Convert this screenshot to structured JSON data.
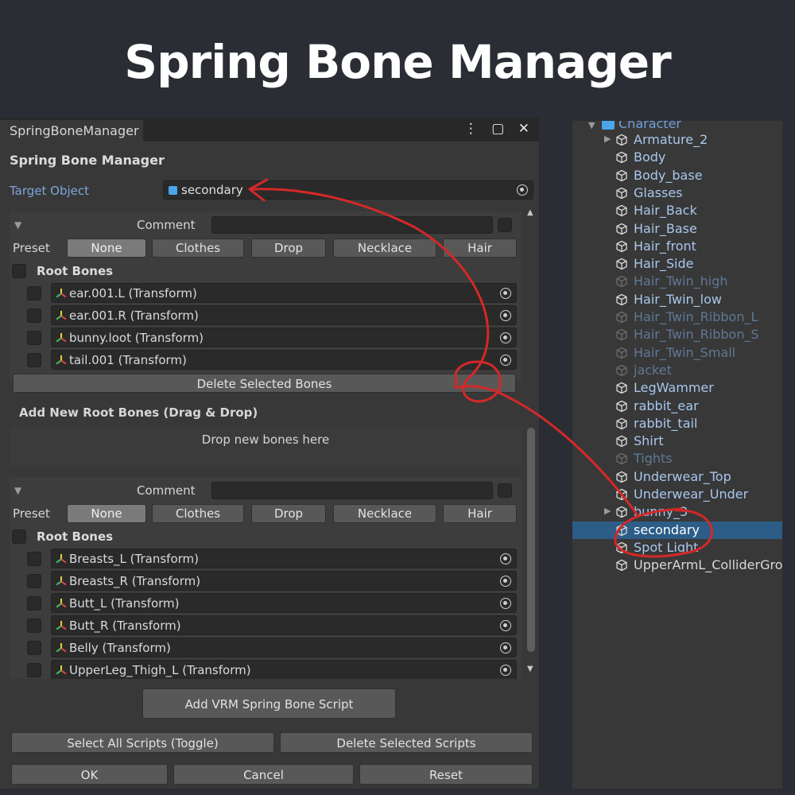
{
  "page_title": "Spring Bone Manager",
  "window": {
    "tab_title": "SpringBoneManager",
    "tab_actions": "⋮ ▢ ✕",
    "heading": "Spring Bone Manager",
    "target_label": "Target Object",
    "target_value": "secondary"
  },
  "preset_labels": {
    "comment": "Comment",
    "preset": "Preset",
    "root_bones": "Root Bones",
    "buttons": [
      "None",
      "Clothes",
      "Drop",
      "Necklace",
      "Hair"
    ]
  },
  "groups": [
    {
      "active_preset": "None",
      "bones": [
        "ear.001.L (Transform)",
        "ear.001.R (Transform)",
        "bunny.loot (Transform)",
        "tail.001 (Transform)"
      ],
      "delete_label": "Delete Selected Bones"
    },
    {
      "active_preset": "None",
      "bones": [
        "Breasts_L (Transform)",
        "Breasts_R (Transform)",
        "Butt_L (Transform)",
        "Butt_R (Transform)",
        "Belly (Transform)",
        "UpperLeg_Thigh_L (Transform)"
      ]
    }
  ],
  "add_root": {
    "heading": "Add New Root Bones (Drag & Drop)",
    "drop_hint": "Drop new bones here"
  },
  "buttons": {
    "add_script": "Add VRM Spring Bone Script",
    "select_all": "Select All Scripts (Toggle)",
    "delete_scripts": "Delete Selected Scripts",
    "ok": "OK",
    "cancel": "Cancel",
    "reset": "Reset"
  },
  "hierarchy": {
    "root": "Character",
    "items": [
      {
        "name": "Armature_2",
        "expandable": true
      },
      {
        "name": "Body"
      },
      {
        "name": "Body_base"
      },
      {
        "name": "Glasses"
      },
      {
        "name": "Hair_Back"
      },
      {
        "name": "Hair_Base"
      },
      {
        "name": "Hair_front"
      },
      {
        "name": "Hair_Side"
      },
      {
        "name": "Hair_Twin_high",
        "inactive": true
      },
      {
        "name": "Hair_Twin_low"
      },
      {
        "name": "Hair_Twin_Ribbon_L",
        "inactive": true
      },
      {
        "name": "Hair_Twin_Ribbon_S",
        "inactive": true
      },
      {
        "name": "Hair_Twin_Small",
        "inactive": true
      },
      {
        "name": "jacket",
        "inactive": true
      },
      {
        "name": "LegWammer"
      },
      {
        "name": "rabbit_ear"
      },
      {
        "name": "rabbit_tail"
      },
      {
        "name": "Shirt"
      },
      {
        "name": "Tights",
        "inactive": true
      },
      {
        "name": "Underwear_Top"
      },
      {
        "name": "Underwear_Under"
      },
      {
        "name": "bunny_3",
        "expandable": true
      },
      {
        "name": "secondary",
        "selected": true
      },
      {
        "name": "Spot Light"
      },
      {
        "name": "UpperArmL_ColliderGroup",
        "plain": true
      }
    ]
  },
  "colors": {
    "background": "#2b2d35",
    "panel": "#383838",
    "field": "#2a2a2a",
    "button": "#585858",
    "selection": "#2c5d87",
    "link_text": "#a9c7ee",
    "annotation": "#d42828"
  }
}
